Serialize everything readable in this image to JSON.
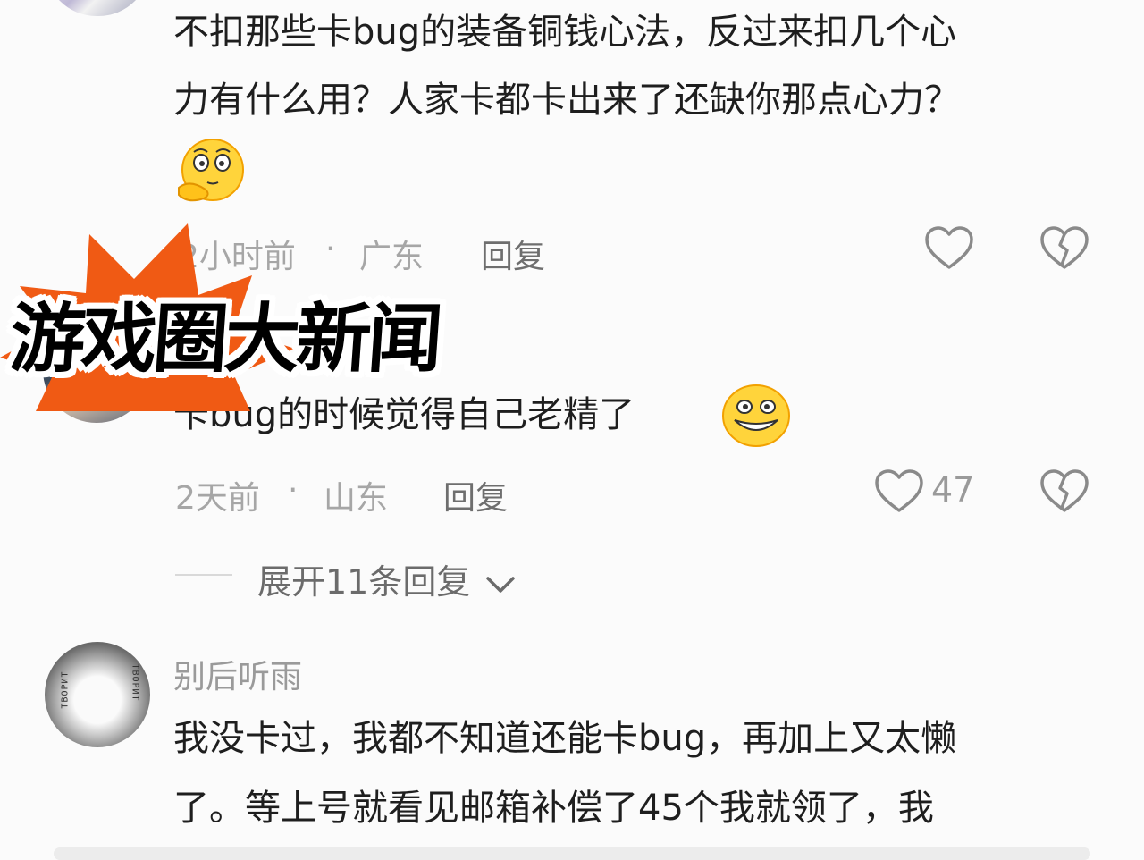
{
  "comments": [
    {
      "text_lines": [
        "不扣那些卡bug的装备铜钱心法，反过来扣几个心",
        "力有什么用？人家卡都卡出来了还缺你那点心力？"
      ],
      "emoji": "thinking-face-emoji",
      "time": "2小时前",
      "location": "广东",
      "reply": "回复"
    },
    {
      "text": "卡bug的时候觉得自己老精了",
      "emoji": "grinning-face-emoji",
      "time": "2天前",
      "location": "山东",
      "reply": "回复",
      "likes": "47",
      "expand": "展开11条回复"
    },
    {
      "username": "别后听雨",
      "text_lines": [
        "我没卡过，我都不知道还能卡bug，再加上又太懒",
        "了。等上号就看见邮箱补偿了45个我就领了，我"
      ]
    }
  ],
  "separator": "·",
  "overlay": {
    "banner_text": "游戏圈大新闻",
    "colors": {
      "burst": "#f05a14",
      "text": "#000000",
      "outline": "#ffffff"
    }
  },
  "avatar_tags": {
    "left": "ТВОРИТ",
    "right": "ТВОРИТ"
  },
  "icons": [
    "heart-outline-icon",
    "broken-heart-icon",
    "chevron-down-icon"
  ]
}
